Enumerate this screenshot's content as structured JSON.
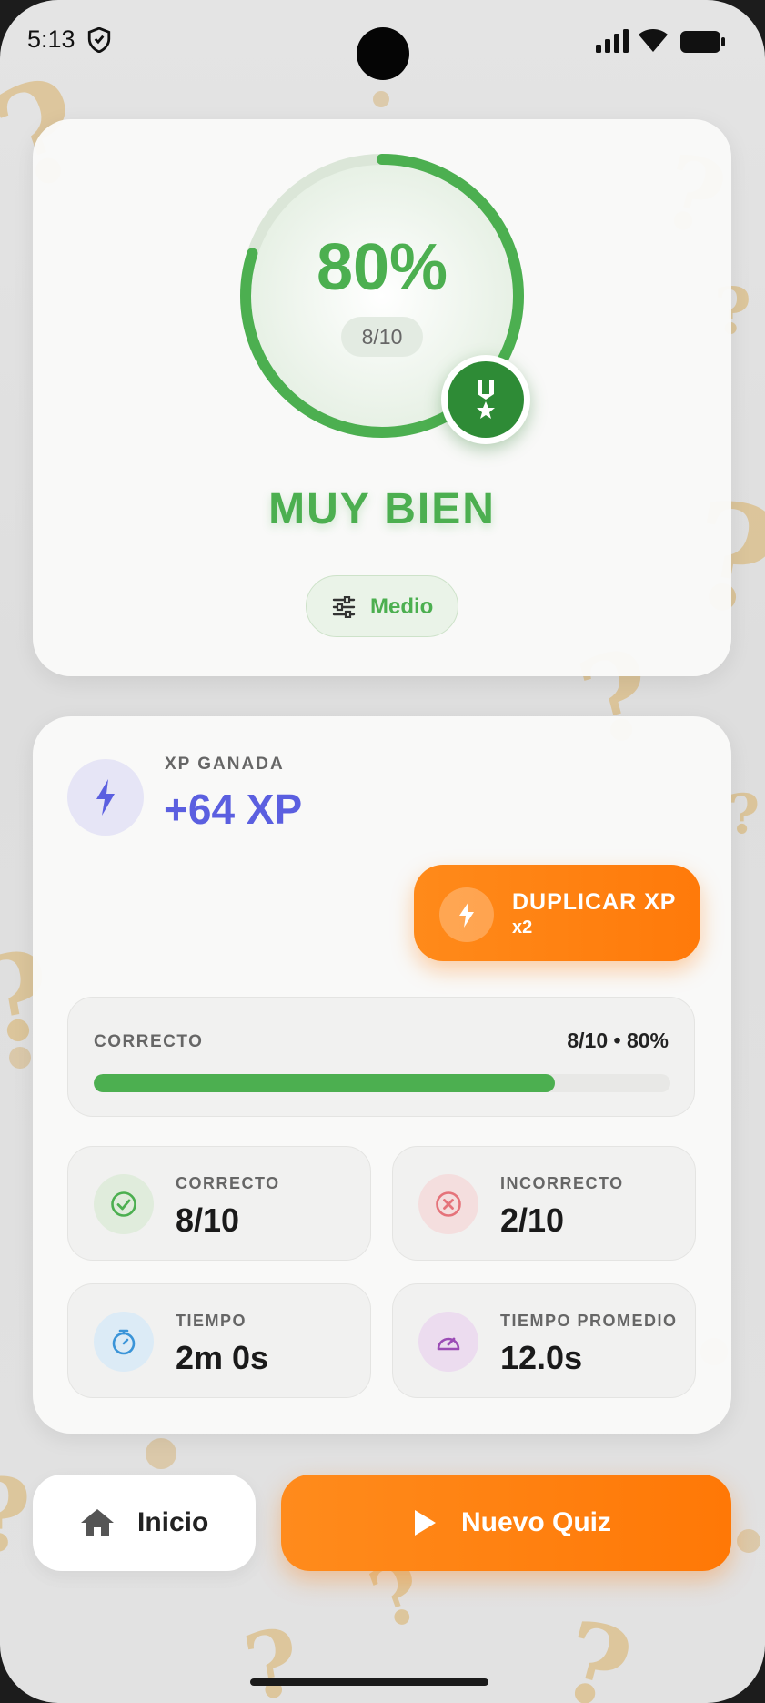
{
  "status_bar": {
    "time": "5:13"
  },
  "result": {
    "percent": "80%",
    "percent_value": 0.8,
    "score": "8/10",
    "verdict": "MUY BIEN",
    "difficulty": "Medio"
  },
  "xp": {
    "label": "XP GANADA",
    "value": "+64 XP",
    "double_label": "DUPLICAR XP",
    "double_sub": "x2"
  },
  "progress": {
    "label": "CORRECTO",
    "stat": "8/10 • 80%",
    "fraction": 0.8
  },
  "stats": [
    {
      "label": "CORRECTO",
      "value": "8/10",
      "icon": "check-circle-icon"
    },
    {
      "label": "INCORRECTO",
      "value": "2/10",
      "icon": "x-circle-icon"
    },
    {
      "label": "TIEMPO",
      "value": "2m 0s",
      "icon": "stopwatch-icon"
    },
    {
      "label": "TIEMPO PROMEDIO",
      "value": "12.0s",
      "icon": "speedometer-icon"
    }
  ],
  "actions": {
    "home": "Inicio",
    "new_quiz": "Nuevo Quiz"
  },
  "colors": {
    "success": "#4caf50",
    "xp": "#5b5fe0",
    "accent": "#ff7a0a",
    "error": "#e5737a"
  }
}
